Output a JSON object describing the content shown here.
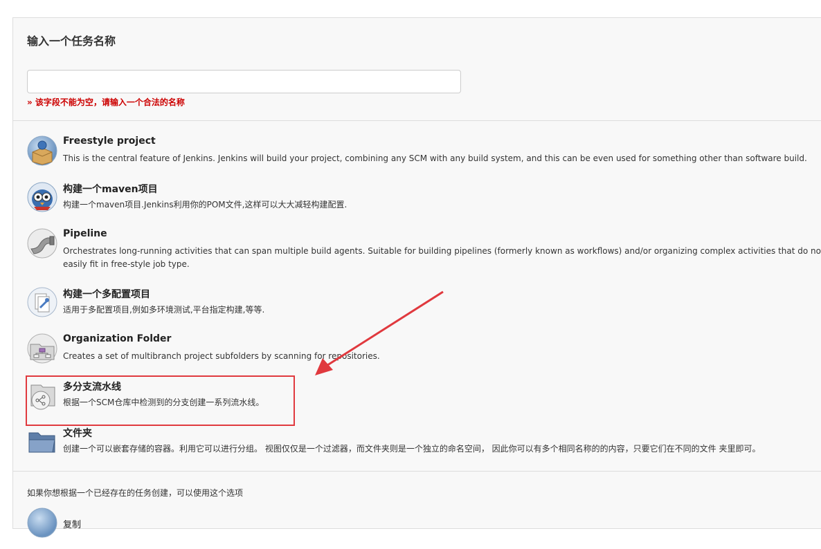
{
  "name_section": {
    "title": "输入一个任务名称",
    "input_value": "",
    "error": "» 该字段不能为空，请输入一个合法的名称"
  },
  "items": [
    {
      "label": "Freestyle project",
      "desc": "This is the central feature of Jenkins. Jenkins will build your project, combining any SCM with any build system, and this can be even used for something other than software build.",
      "icon": "freestyle-box-icon"
    },
    {
      "label": "构建一个maven项目",
      "desc": "构建一个maven项目.Jenkins利用你的POM文件,这样可以大大减轻构建配置.",
      "icon": "maven-owl-icon"
    },
    {
      "label": "Pipeline",
      "desc": "Orchestrates long-running activities that can span multiple build agents. Suitable for building pipelines (formerly known as workflows) and/or organizing complex activities that do not easily fit in free-style job type.",
      "icon": "pipeline-pipe-icon"
    },
    {
      "label": "构建一个多配置项目",
      "desc": "适用于多配置项目,例如多环境测试,平台指定构建,等等.",
      "icon": "multi-config-icon"
    },
    {
      "label": "Organization Folder",
      "desc": "Creates a set of multibranch project subfolders by scanning for repositories.",
      "icon": "organization-folder-icon"
    },
    {
      "label": "多分支流水线",
      "desc": "根据一个SCM仓库中检测到的分支创建一系列流水线。",
      "icon": "multibranch-pipeline-icon"
    },
    {
      "label": "文件夹",
      "desc": "创建一个可以嵌套存储的容器。利用它可以进行分组。 视图仅仅是一个过滤器，而文件夹则是一个独立的命名空间， 因此你可以有多个相同名称的的内容，只要它们在不同的文件 夹里即可。",
      "icon": "folder-icon"
    }
  ],
  "copy_section": {
    "hint": "如果你想根据一个已经存在的任务创建，可以使用这个选项",
    "copy_label": "复制"
  },
  "colors": {
    "error": "#cc0000",
    "highlight": "#e0393e"
  }
}
